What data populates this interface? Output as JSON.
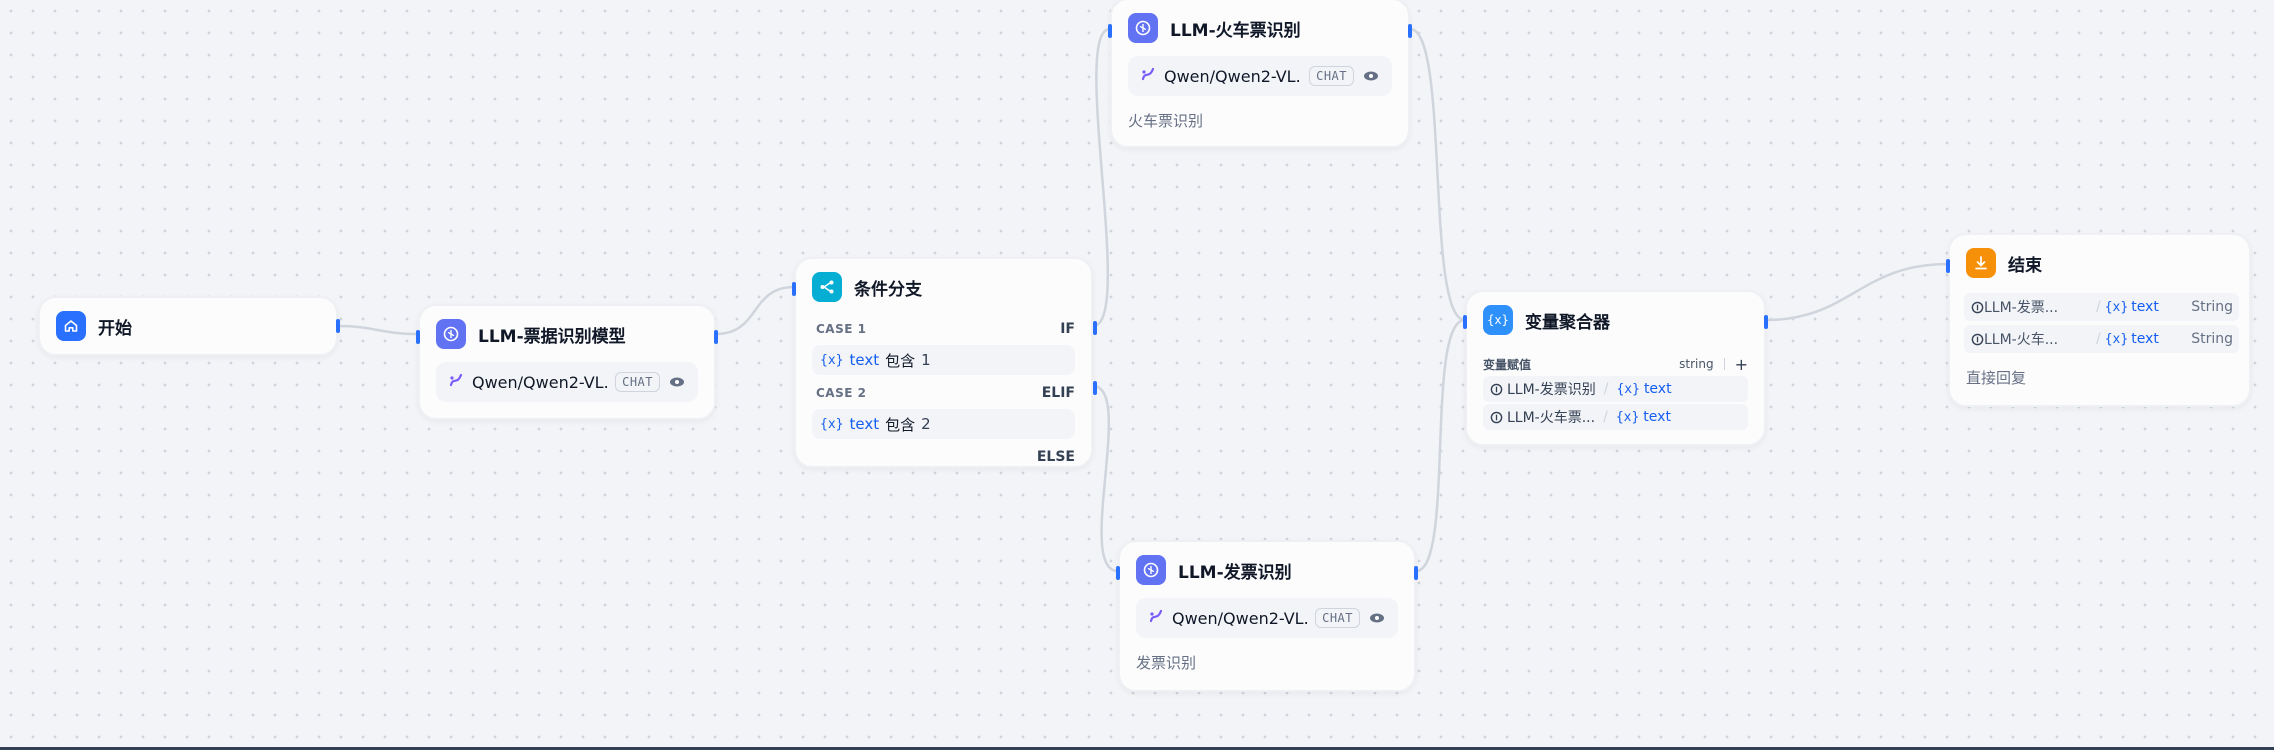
{
  "nodes": {
    "start": {
      "title": "开始"
    },
    "llm_bill": {
      "title": "LLM-票据识别模型",
      "model": "Qwen/Qwen2-VL...",
      "badge": "CHAT"
    },
    "if_else": {
      "title": "条件分支",
      "cases": [
        {
          "label": "CASE 1",
          "branch": "IF",
          "var_symbol": "{x}",
          "var": "text",
          "op": "包含",
          "value": "1"
        },
        {
          "label": "CASE 2",
          "branch": "ELIF",
          "var_symbol": "{x}",
          "var": "text",
          "op": "包含",
          "value": "2"
        }
      ],
      "else_label": "ELSE"
    },
    "llm_train": {
      "title": "LLM-火车票识别",
      "model": "Qwen/Qwen2-VL...",
      "badge": "CHAT",
      "desc": "火车票识别"
    },
    "llm_invoice": {
      "title": "LLM-发票识别",
      "model": "Qwen/Qwen2-VL...",
      "badge": "CHAT",
      "desc": "发票识别"
    },
    "aggregator": {
      "title": "变量聚合器",
      "section_label": "变量赋值",
      "type": "string",
      "plus": "+",
      "items": [
        {
          "source": "LLM-发票识别",
          "var_symbol": "{x}",
          "var": "text"
        },
        {
          "source": "LLM-火车票...",
          "var_symbol": "{x}",
          "var": "text"
        }
      ]
    },
    "end": {
      "title": "结束",
      "outputs": [
        {
          "source": "LLM-发票...",
          "var_symbol": "{x}",
          "var": "text",
          "type": "String"
        },
        {
          "source": "LLM-火车...",
          "var_symbol": "{x}",
          "var": "text",
          "type": "String"
        }
      ],
      "desc": "直接回复"
    }
  },
  "colors": {
    "start_icon": "#2970ff",
    "llm_icon": "#6172f3",
    "if_icon": "#06aed4",
    "agg_icon": "#2e90fa",
    "end_icon": "#f79009",
    "handle": "#2970ff",
    "edge": "#d0d5dd",
    "var_blue": "#155eef"
  }
}
